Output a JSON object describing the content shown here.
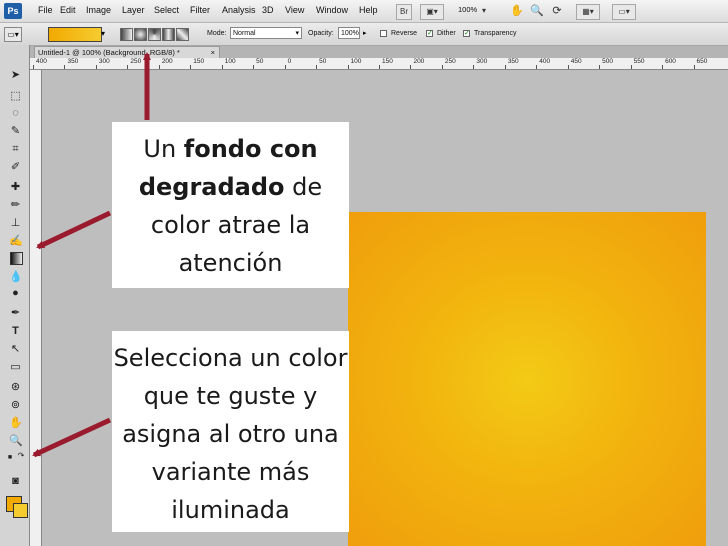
{
  "app": {
    "logo": "Ps",
    "menu": [
      "File",
      "Edit",
      "Image",
      "Layer",
      "Select",
      "Filter",
      "Analysis",
      "3D",
      "View",
      "Window",
      "Help"
    ],
    "zoom": "100%",
    "icons": [
      "bridge-icon",
      "screen-mode-icon",
      "hand-icon",
      "zoom-icon",
      "rotate-icon",
      "arrange-icon"
    ]
  },
  "options_bar": {
    "mode_label": "Mode:",
    "mode_value": "Normal",
    "opacity_label": "Opacity:",
    "opacity_value": "100%",
    "reverse_label": "Reverse",
    "dither_label": "Dither",
    "transparency_label": "Transparency"
  },
  "document": {
    "tab_title": "Untitled-1 @ 100% (Background, RGB/8) *",
    "close": "×"
  },
  "ruler": {
    "top_numbers": [
      "400",
      "350",
      "300",
      "250",
      "200",
      "150",
      "100",
      "50",
      "0",
      "50",
      "100",
      "150",
      "200",
      "250",
      "300",
      "350",
      "400",
      "450",
      "500",
      "550",
      "600",
      "650"
    ]
  },
  "colors": {
    "foreground": "#f2a900",
    "background": "#f5cc30",
    "arrow": "#9b1b2e"
  },
  "callouts": {
    "top": {
      "pre": "Un ",
      "bold": "fondo con degradado",
      "post": " de color atrae la atención"
    },
    "bottom": "Selecciona un color que te guste y asigna al otro una variante más iluminada"
  }
}
